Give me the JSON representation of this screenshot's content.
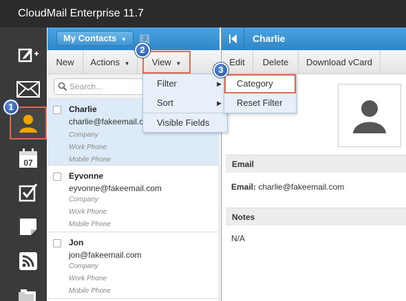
{
  "app": {
    "title": "CloudMail Enterprise 11.7"
  },
  "rail": {
    "items": [
      {
        "icon": "compose-icon"
      },
      {
        "icon": "mail-icon"
      },
      {
        "icon": "contacts-icon",
        "active": true
      },
      {
        "icon": "calendar-icon",
        "label": "07"
      },
      {
        "icon": "tasks-icon"
      },
      {
        "icon": "notes-icon"
      },
      {
        "icon": "rss-icon"
      },
      {
        "icon": "folders-icon"
      }
    ]
  },
  "list": {
    "folder_button": "My Contacts",
    "count": "3",
    "toolbar": {
      "new": "New",
      "actions": "Actions",
      "view": "View"
    },
    "search_placeholder": "Search...",
    "contacts": [
      {
        "name": "Charlie",
        "email": "charlie@fakeemail.com",
        "company": "Company",
        "work_phone": "Work Phone",
        "mobile_phone": "Mobile Phone"
      },
      {
        "name": "Eyvonne",
        "email": "eyvonne@fakeemail.com",
        "company": "Company",
        "work_phone": "Work Phone",
        "mobile_phone": "Mobile Phone"
      },
      {
        "name": "Jon",
        "email": "jon@fakeemail.com",
        "company": "Company",
        "work_phone": "Work Phone",
        "mobile_phone": "Mobile Phone"
      }
    ]
  },
  "view_menu": {
    "items": [
      "Filter",
      "Sort",
      "Visible Fields"
    ],
    "filter_submenu": [
      "Category",
      "Reset Filter"
    ]
  },
  "detail": {
    "title": "Charlie",
    "toolbar": {
      "edit": "Edit",
      "delete": "Delete",
      "download": "Download vCard"
    },
    "email_section": "Email",
    "email_label": "Email:",
    "email_value": "charlie@fakeemail.com",
    "notes_section": "Notes",
    "notes_value": "N/A"
  },
  "steps": [
    "1",
    "2",
    "3"
  ],
  "colors": {
    "accent": "#2f86c8",
    "highlight": "#e06a4e",
    "rail": "#3a3a3a",
    "step": "#1f4f9c"
  }
}
